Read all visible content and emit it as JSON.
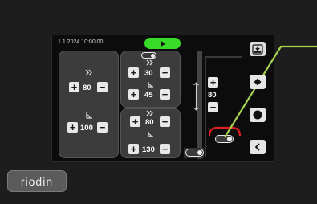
{
  "header": {
    "datetime": "1.1.2024 10:00:00"
  },
  "left_panel": {
    "upper_value": "80",
    "lower_value": "100"
  },
  "right_top_panel": {
    "value_1": "30",
    "value_2": "45"
  },
  "right_bottom_panel": {
    "value_1": "80",
    "value_2": "130"
  },
  "center_column": {
    "value": "80"
  },
  "brand": {
    "logo_text": "riodin"
  },
  "colors": {
    "accent_green": "#38dc28",
    "callout_line": "#a6d34a",
    "alert_red": "#e02020"
  }
}
